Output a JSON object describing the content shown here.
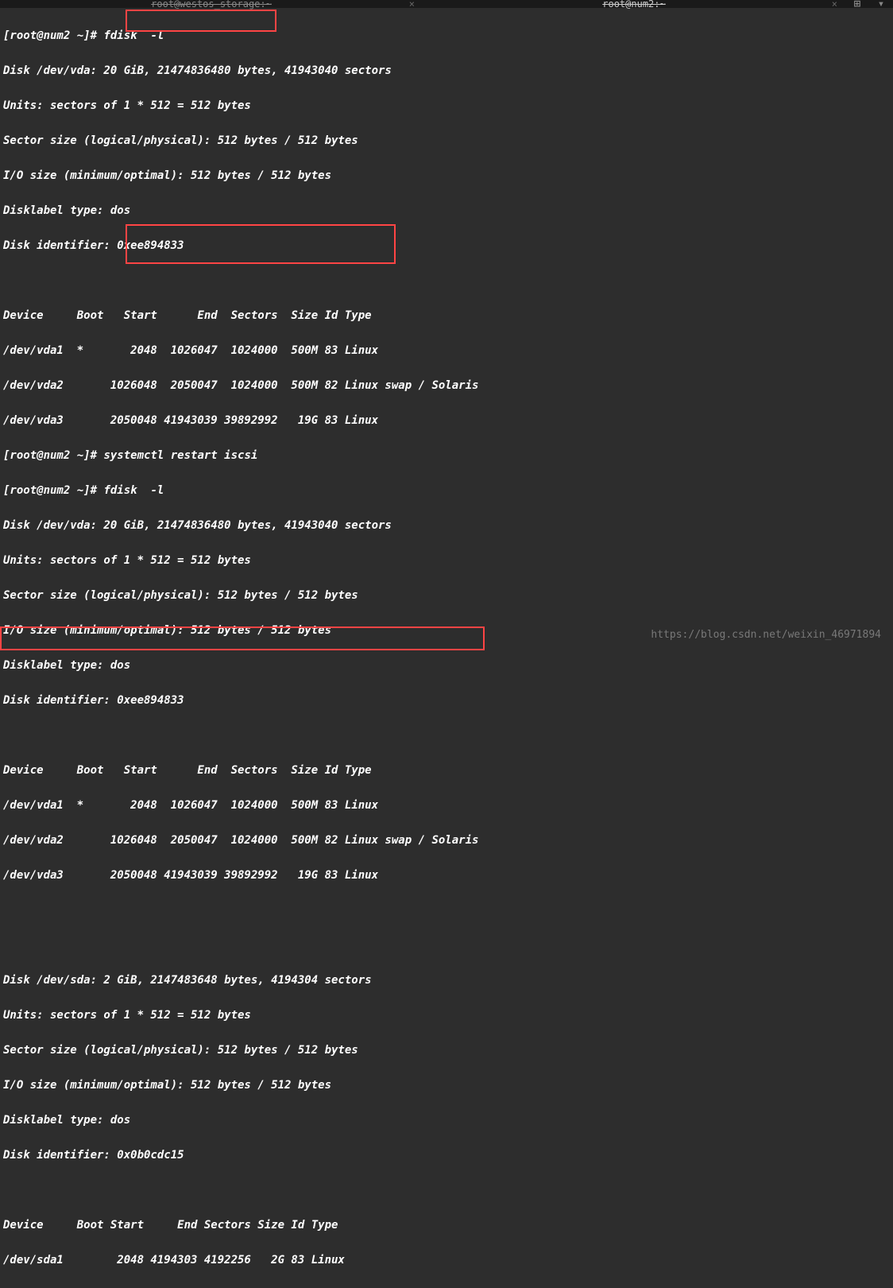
{
  "tabs": {
    "tab1": "root@westos_storage:~",
    "tab2": "root@num2:~"
  },
  "prompt1": "[root@num2 ~]#",
  "cmd1": " fdisk  -l",
  "disk_vda_header": "Disk /dev/vda: 20 GiB, 21474836480 bytes, 41943040 sectors",
  "units": "Units: sectors of 1 * 512 = 512 bytes",
  "sector_size": "Sector size (logical/physical): 512 bytes / 512 bytes",
  "io_size": "I/O size (minimum/optimal): 512 bytes / 512 bytes",
  "disklabel": "Disklabel type: dos",
  "disk_id_vda": "Disk identifier: 0xee894833",
  "table_header1": "Device     Boot   Start      End  Sectors  Size Id Type",
  "vda1": "/dev/vda1  *       2048  1026047  1024000  500M 83 Linux",
  "vda2": "/dev/vda2       1026048  2050047  1024000  500M 82 Linux swap / Solaris",
  "vda3": "/dev/vda3       2050048 41943039 39892992   19G 83 Linux",
  "cmd2": " systemctl restart iscsi",
  "cmd3": " fdisk  -l",
  "disk_sda_header": "Disk /dev/sda: 2 GiB, 2147483648 bytes, 4194304 sectors",
  "disk_id_sda": "Disk identifier: 0x0b0cdc15",
  "table_header2": "Device     Boot Start     End Sectors Size Id Type",
  "sda1": "/dev/sda1        2048 4194303 4192256   2G 83 Linux",
  "watermark": "https://blog.csdn.net/weixin_46971894"
}
